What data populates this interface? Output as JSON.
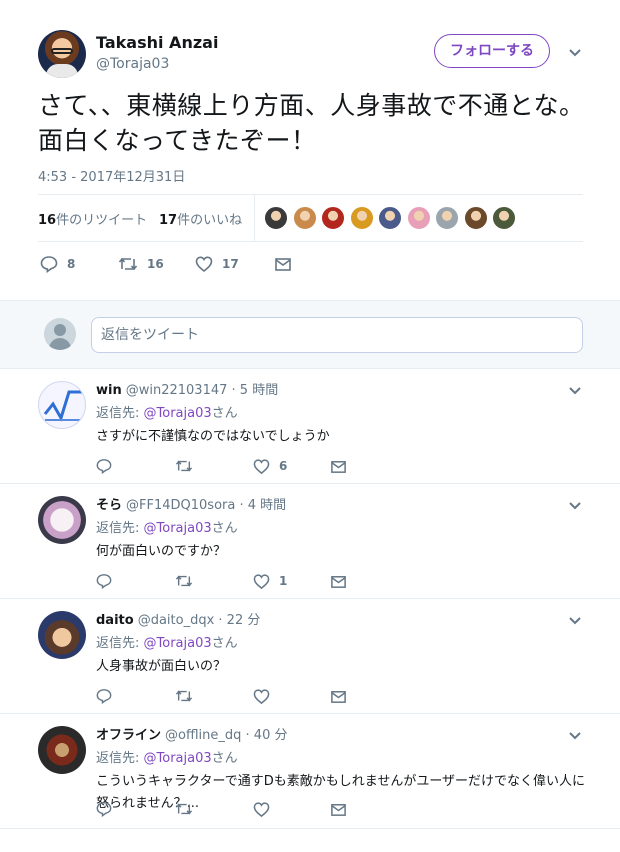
{
  "tweet": {
    "author_name": "Takashi Anzai",
    "author_handle": "@Toraja03",
    "follow_label": "フォローする",
    "text": "さて、、東横線上り方面、人身事故で不通とな。面白くなってきたぞー！",
    "timestamp": "4:53 - 2017年12月31日",
    "retweets_count": "16",
    "retweets_label": "件のリツイート",
    "likes_count": "17",
    "likes_label": "件のいいね",
    "likers": [
      "#3a3a3a",
      "#c98a4b",
      "#b2281f",
      "#d89a20",
      "#4a5a8a",
      "#e8a0b8",
      "#9aa5ae",
      "#6a4a2a",
      "#4a5a3a"
    ],
    "actions": {
      "reply_count": "8",
      "retweet_count": "16",
      "like_count": "17"
    }
  },
  "reply_box": {
    "placeholder": "返信をツイート"
  },
  "replies": [
    {
      "name": "win",
      "handle": "@win22103147",
      "time": "· 5 時間",
      "to_label": "返信先:",
      "mention": "@Toraja03",
      "suffix": "さん",
      "text": "さすがに不謹慎なのではないでしょうか",
      "like_count": "6",
      "avatar": "chart"
    },
    {
      "name": "そら",
      "handle": "@FF14DQ10sora",
      "time": "· 4 時間",
      "to_label": "返信先:",
      "mention": "@Toraja03",
      "suffix": "さん",
      "text": "何が面白いのですか？",
      "like_count": "1",
      "avatar": "anime-girl"
    },
    {
      "name": "daito",
      "handle": "@daito_dqx",
      "time": "· 22 分",
      "to_label": "返信先:",
      "mention": "@Toraja03",
      "suffix": "さん",
      "text": "人身事故が面白いの？",
      "like_count": "",
      "avatar": "anime-boy"
    },
    {
      "name": "オフライン",
      "handle": "@offline_dq",
      "time": "· 40 分",
      "to_label": "返信先:",
      "mention": "@Toraja03",
      "suffix": "さん",
      "text": "こういうキャラクターで通すDも素敵かもしれませんがユーザーだけでなく偉い人に怒られません？...",
      "like_count": "",
      "avatar": "mask"
    }
  ],
  "colors": {
    "accent": "#7f48c2",
    "muted": "#657786",
    "border": "#e6ecf0"
  }
}
